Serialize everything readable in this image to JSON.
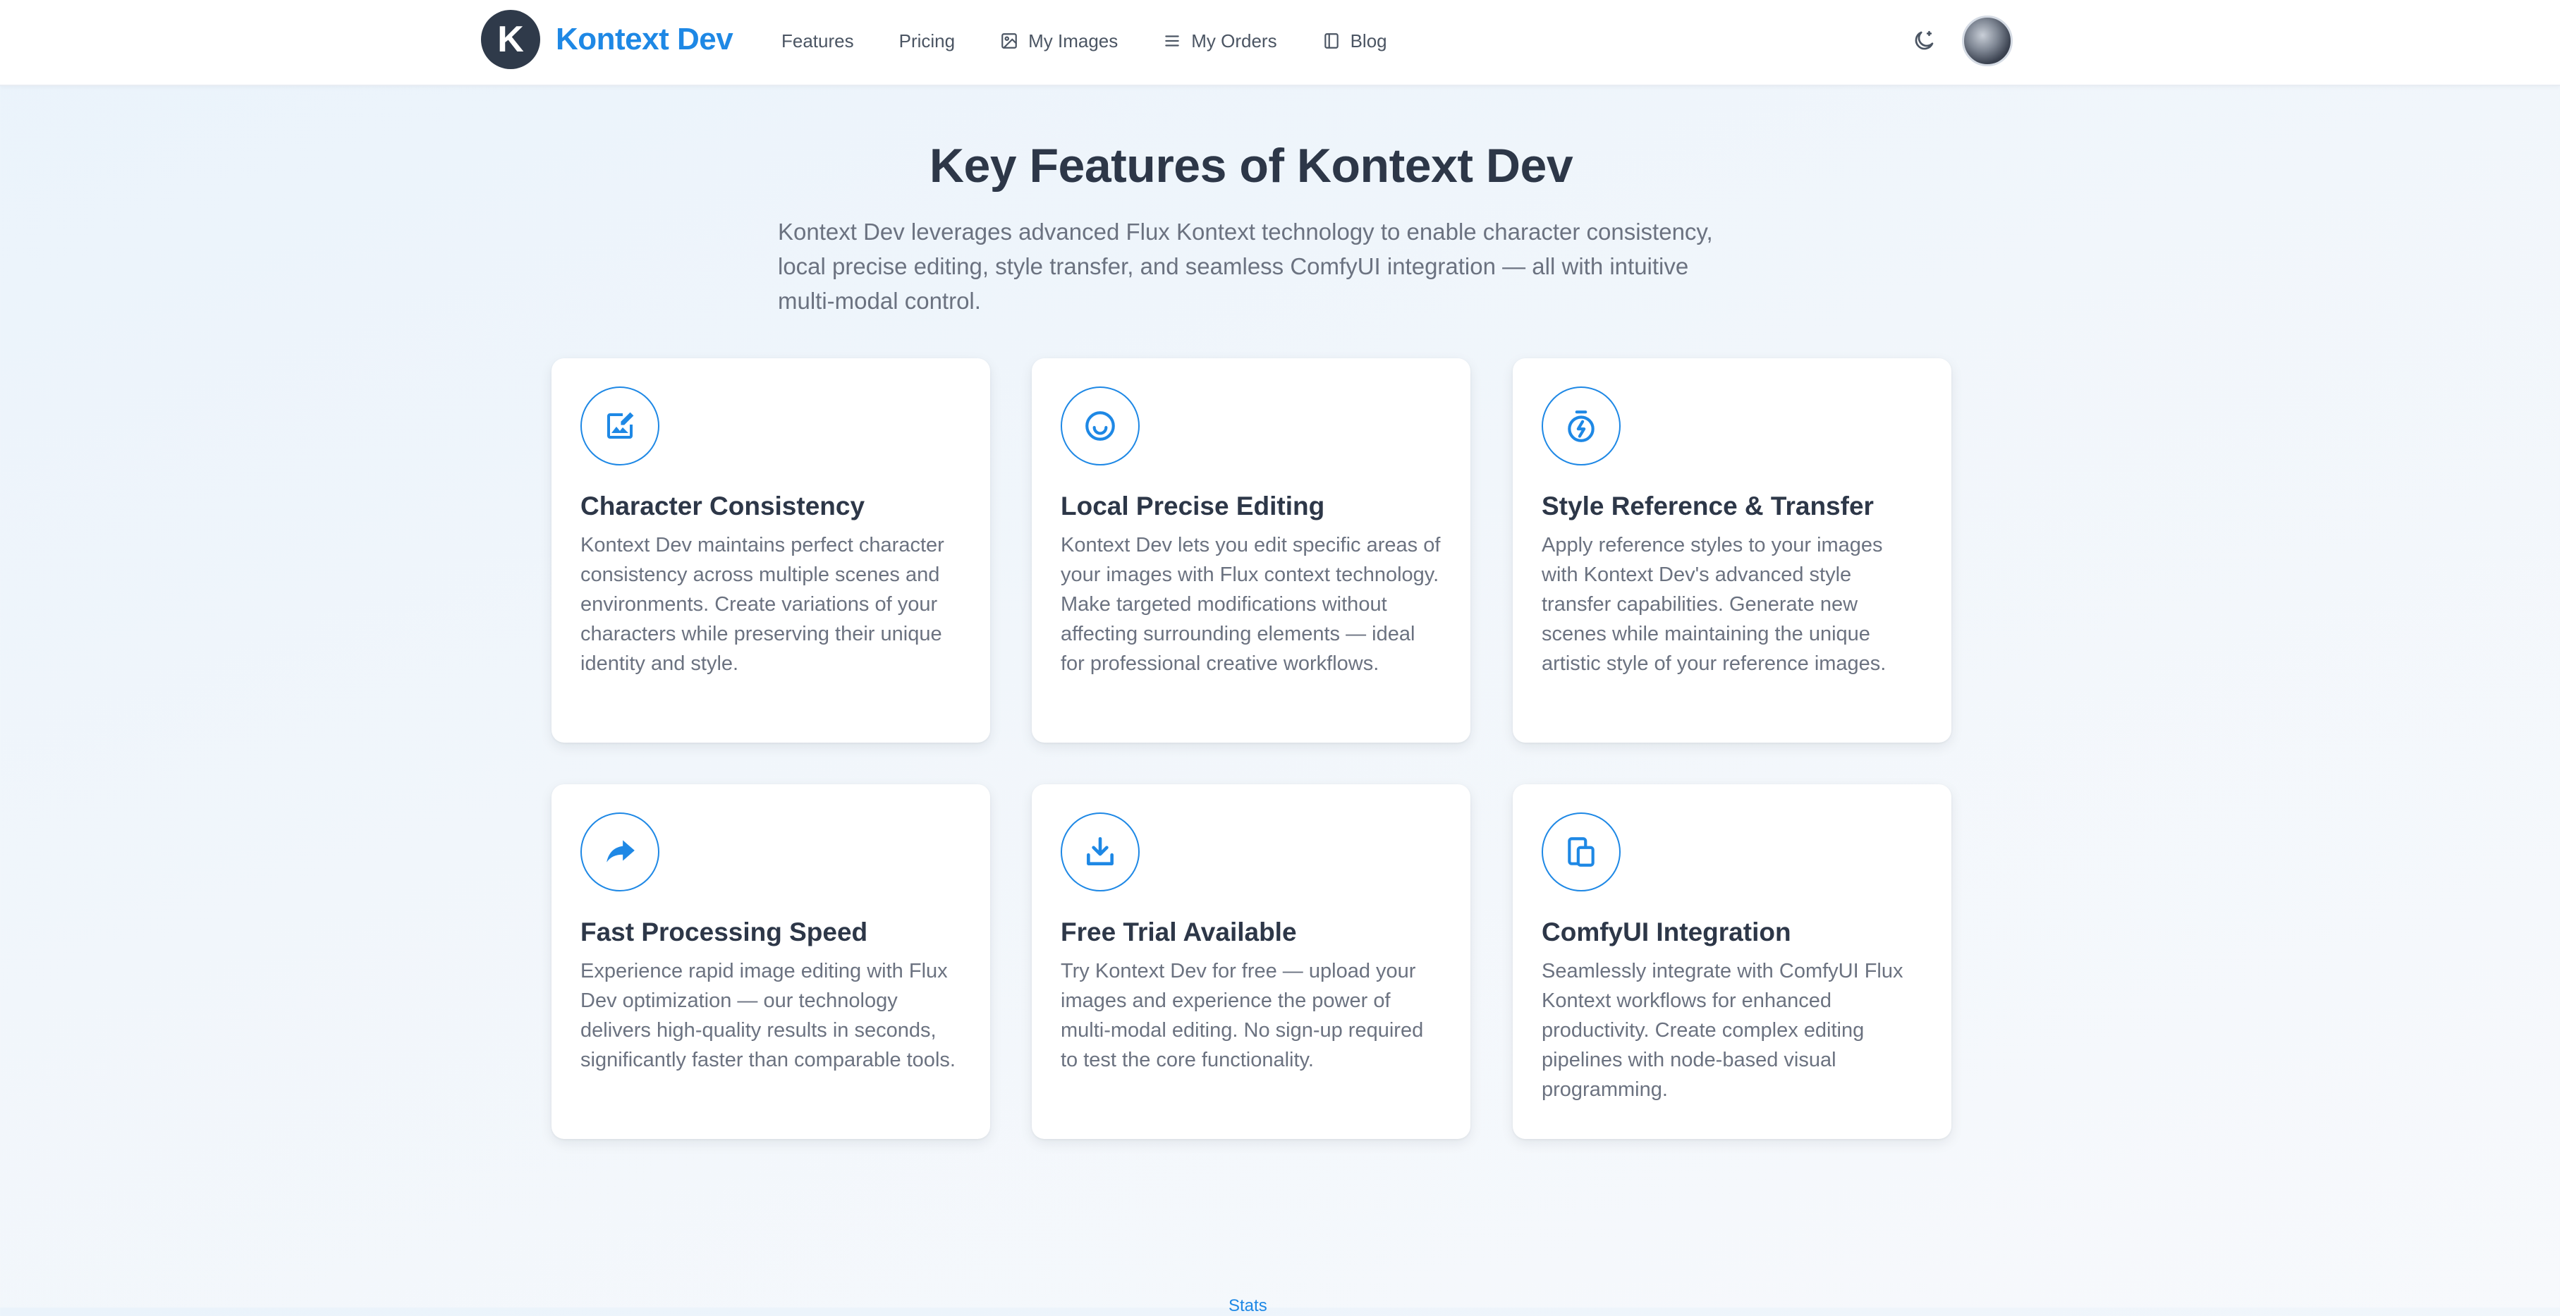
{
  "nav": {
    "logo_letter": "K",
    "brand": "Kontext Dev",
    "links": [
      {
        "label": "Features",
        "icon": null
      },
      {
        "label": "Pricing",
        "icon": null
      },
      {
        "label": "My Images",
        "icon": "image-icon"
      },
      {
        "label": "My Orders",
        "icon": "list-icon"
      },
      {
        "label": "Blog",
        "icon": "book-icon"
      }
    ],
    "theme_icon": "moon-icon"
  },
  "header": {
    "title": "Key Features of Kontext Dev",
    "subtitle": "Kontext Dev leverages advanced Flux Kontext technology to enable character consistency, local precise editing, style transfer, and seamless ComfyUI integration — all with intuitive multi-modal control."
  },
  "features": [
    {
      "icon": "image-edit-icon",
      "title": "Character Consistency",
      "description": "Kontext Dev maintains perfect character consistency across multiple scenes and environments. Create variations of your characters while preserving their unique identity and style."
    },
    {
      "icon": "smile-icon",
      "title": "Local Precise Editing",
      "description": "Kontext Dev lets you edit specific areas of your images with Flux context technology. Make targeted modifications without affecting surrounding elements — ideal for professional creative workflows."
    },
    {
      "icon": "stopwatch-bolt-icon",
      "title": "Style Reference & Transfer",
      "description": "Apply reference styles to your images with Kontext Dev's advanced style transfer capabilities. Generate new scenes while maintaining the unique artistic style of your reference images."
    },
    {
      "icon": "share-arrow-icon",
      "title": "Fast Processing Speed",
      "description": "Experience rapid image editing with Flux Dev optimization — our technology delivers high-quality results in seconds, significantly faster than comparable tools."
    },
    {
      "icon": "download-tray-icon",
      "title": "Free Trial Available",
      "description": "Try Kontext Dev for free — upload your images and experience the power of multi-modal editing. No sign-up required to test the core functionality."
    },
    {
      "icon": "devices-icon",
      "title": "ComfyUI Integration",
      "description": "Seamlessly integrate with ComfyUI Flux Kontext workflows for enhanced productivity. Create complex editing pipelines with node-based visual programming."
    }
  ],
  "footer_peek": {
    "label": "Stats"
  },
  "colors": {
    "accent": "#1e88e5",
    "heading": "#2d3748",
    "body_text": "#6b7280",
    "logo_bg": "#2f3a4a"
  }
}
